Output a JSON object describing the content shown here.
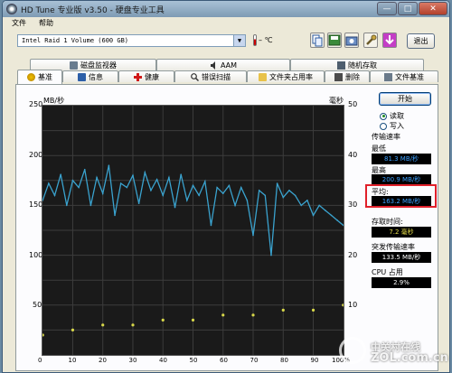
{
  "window": {
    "title": "HD Tune 专业版 v3.50 - 硬盘专业工具"
  },
  "titlebar": {
    "minimize_glyph": "—",
    "maximize_glyph": "□",
    "close_glyph": "✕"
  },
  "menu": [
    "文件",
    "帮助"
  ],
  "toolbar": {
    "drive": "Intel   Raid 1 Volume (600 GB)",
    "dropdown_glyph": "▼",
    "temperature": "– ℃",
    "exit_label": "退出"
  },
  "tabs_top": [
    "磁盘监视器",
    "AAM",
    "随机存取"
  ],
  "tabs_bottom": [
    "基准",
    "信息",
    "健康",
    "错误扫描",
    "文件夹占用率",
    "删除",
    "文件基准"
  ],
  "chart": {
    "y_left_unit": "MB/秒",
    "y_right_unit": "毫秒",
    "y_left_ticks": [
      "250",
      "200",
      "150",
      "100",
      "50"
    ],
    "y_right_ticks": [
      "50",
      "40",
      "30",
      "20",
      "10"
    ],
    "x_ticks": [
      "0",
      "10",
      "20",
      "30",
      "40",
      "50",
      "60",
      "70",
      "80",
      "90",
      "100%"
    ]
  },
  "side": {
    "start_label": "开始",
    "mode_read": "读取",
    "mode_write": "写入",
    "transfer_rate_label": "传输速率",
    "min_label": "最低",
    "min_value": "81.3 MB/秒",
    "max_label": "最高",
    "max_value": "200.9 MB/秒",
    "avg_label": "平均:",
    "avg_value": "163.2 MB/秒",
    "access_label": "存取时间:",
    "access_value": "7.2 毫秒",
    "burst_label": "突发传输速率",
    "burst_value": "133.5 MB/秒",
    "cpu_label": "CPU 占用",
    "cpu_value": "2.9%"
  },
  "watermark": {
    "line1": "中关村在线",
    "line2": "ZOL.com.cn"
  },
  "chart_data": {
    "type": "line",
    "ylabel_left": "MB/秒",
    "ylabel_right": "毫秒",
    "ylim_left": [
      0,
      250
    ],
    "ylim_right": [
      0,
      50
    ],
    "xlim": [
      0,
      100
    ],
    "grid": true,
    "series": [
      {
        "name": "传输速率",
        "color": "#3aa3cf",
        "x": [
          0,
          2,
          4,
          6,
          8,
          10,
          12,
          14,
          16,
          18,
          20,
          22,
          24,
          26,
          28,
          30,
          32,
          34,
          36,
          38,
          40,
          42,
          44,
          46,
          48,
          50,
          52,
          54,
          56,
          58,
          60,
          62,
          64,
          66,
          68,
          70,
          72,
          74,
          76,
          78,
          80,
          82,
          84,
          86,
          88,
          90,
          92,
          94,
          96,
          98,
          100
        ],
        "y": [
          155,
          172,
          160,
          181,
          150,
          175,
          168,
          186,
          150,
          178,
          162,
          190,
          140,
          172,
          168,
          180,
          152,
          183,
          165,
          176,
          160,
          178,
          148,
          181,
          155,
          170,
          160,
          174,
          130,
          168,
          162,
          170,
          150,
          168,
          155,
          120,
          165,
          160,
          100,
          172,
          158,
          165,
          160,
          150,
          155,
          140,
          150,
          145,
          140,
          135,
          130
        ]
      },
      {
        "name": "存取时间",
        "color": "#d8d84a",
        "x": [
          0,
          10,
          20,
          30,
          40,
          50,
          60,
          70,
          80,
          90,
          100
        ],
        "y": [
          4,
          5,
          6,
          6,
          7,
          7,
          8,
          8,
          9,
          9,
          10
        ]
      }
    ]
  }
}
